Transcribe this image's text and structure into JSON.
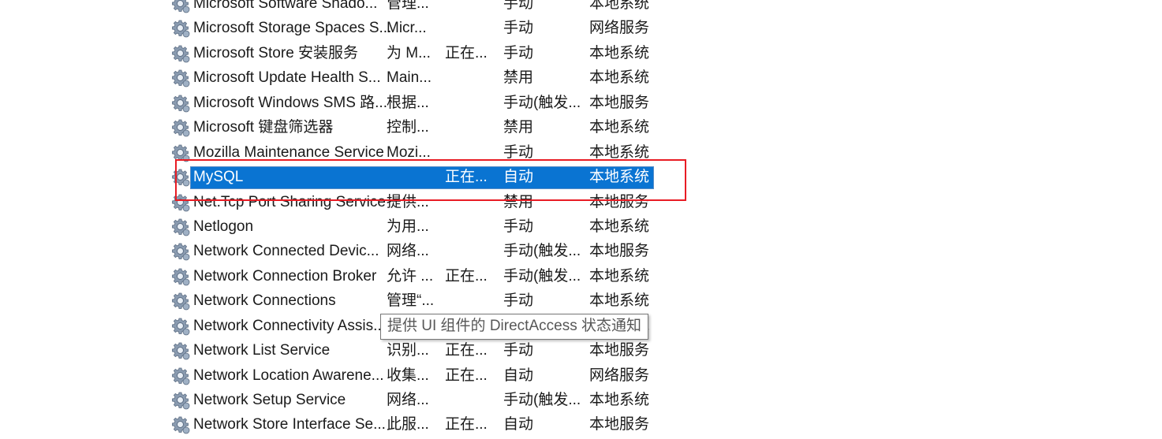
{
  "services": [
    {
      "name": "Microsoft Software Shado...",
      "desc": "管理...",
      "status": "",
      "startup": "手动",
      "logon": "本地系统"
    },
    {
      "name": "Microsoft Storage Spaces S...",
      "desc": "Micr...",
      "status": "",
      "startup": "手动",
      "logon": "网络服务"
    },
    {
      "name": "Microsoft Store 安装服务",
      "desc": "为 M...",
      "status": "正在...",
      "startup": "手动",
      "logon": "本地系统"
    },
    {
      "name": "Microsoft Update Health S...",
      "desc": "Main...",
      "status": "",
      "startup": "禁用",
      "logon": "本地系统"
    },
    {
      "name": "Microsoft Windows SMS 路...",
      "desc": "根据...",
      "status": "",
      "startup": "手动(触发...",
      "logon": "本地服务"
    },
    {
      "name": "Microsoft 键盘筛选器",
      "desc": "控制...",
      "status": "",
      "startup": "禁用",
      "logon": "本地系统"
    },
    {
      "name": "Mozilla Maintenance Service",
      "desc": "Mozi...",
      "status": "",
      "startup": "手动",
      "logon": "本地系统"
    },
    {
      "name": "MySQL",
      "desc": "",
      "status": "正在...",
      "startup": "自动",
      "logon": "本地系统",
      "selected": true
    },
    {
      "name": "Net.Tcp Port Sharing Service",
      "desc": "提供...",
      "status": "",
      "startup": "禁用",
      "logon": "本地服务"
    },
    {
      "name": "Netlogon",
      "desc": "为用...",
      "status": "",
      "startup": "手动",
      "logon": "本地系统"
    },
    {
      "name": "Network Connected Devic...",
      "desc": "网络...",
      "status": "",
      "startup": "手动(触发...",
      "logon": "本地服务"
    },
    {
      "name": "Network Connection Broker",
      "desc": "允许 ...",
      "status": "正在...",
      "startup": "手动(触发...",
      "logon": "本地系统"
    },
    {
      "name": "Network Connections",
      "desc": "管理“...",
      "status": "",
      "startup": "手动",
      "logon": "本地系统"
    },
    {
      "name": "Network Connectivity Assis...",
      "desc": "",
      "status": "",
      "startup": "",
      "logon": "本地系统"
    },
    {
      "name": "Network List Service",
      "desc": "识别...",
      "status": "正在...",
      "startup": "手动",
      "logon": "本地服务"
    },
    {
      "name": "Network Location Awarene...",
      "desc": "收集...",
      "status": "正在...",
      "startup": "自动",
      "logon": "网络服务"
    },
    {
      "name": "Network Setup Service",
      "desc": "网络...",
      "status": "",
      "startup": "手动(触发...",
      "logon": "本地系统"
    },
    {
      "name": "Network Store Interface Se...",
      "desc": "此服...",
      "status": "正在...",
      "startup": "自动",
      "logon": "本地服务"
    }
  ],
  "tooltip": "提供 UI 组件的 DirectAccess 状态通知",
  "colors": {
    "selection": "#0a74d2",
    "highlight_box": "#e81c24"
  }
}
